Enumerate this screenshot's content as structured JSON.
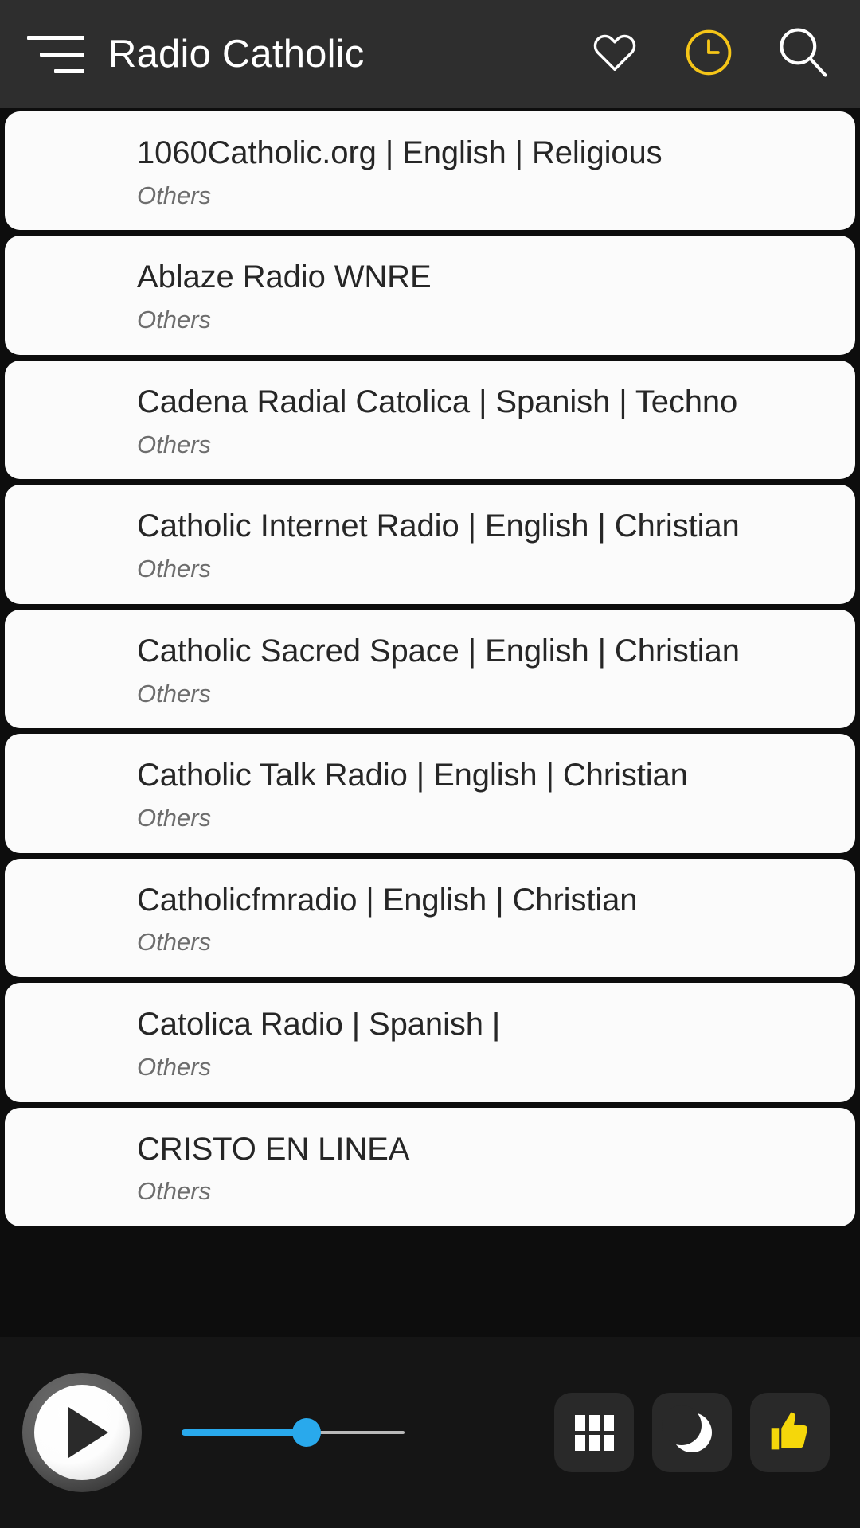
{
  "header": {
    "title": "Radio Catholic",
    "menu_icon": "hamburger-menu-icon",
    "favorites_icon": "heart-icon",
    "recent_icon": "clock-icon",
    "search_icon": "search-icon",
    "background_color": "#2e2e2e",
    "title_color": "#ffffff",
    "accent_color": "#f5c518"
  },
  "stations": [
    {
      "title": "1060Catholic.org | English | Religious",
      "subtitle": "Others"
    },
    {
      "title": "Ablaze Radio WNRE",
      "subtitle": "Others"
    },
    {
      "title": "Cadena Radial Catolica | Spanish | Techno",
      "subtitle": "Others"
    },
    {
      "title": "Catholic Internet Radio | English | Christian",
      "subtitle": "Others"
    },
    {
      "title": "Catholic Sacred Space | English | Christian",
      "subtitle": "Others"
    },
    {
      "title": "Catholic Talk Radio | English | Christian",
      "subtitle": "Others"
    },
    {
      "title": "Catholicfmradio | English | Christian",
      "subtitle": "Others"
    },
    {
      "title": "Catolica Radio | Spanish |",
      "subtitle": "Others"
    },
    {
      "title": "CRISTO EN LINEA",
      "subtitle": "Others"
    }
  ],
  "player": {
    "play_icon": "play-icon",
    "volume": 56,
    "volume_fill_color": "#29a9ec",
    "volume_track_color": "#b9b9b9",
    "equalizer_icon": "grid-icon",
    "sleep_timer_icon": "moon-icon",
    "like_icon": "thumbs-up-icon",
    "like_color": "#f5d70a",
    "background_color": "#151515"
  }
}
